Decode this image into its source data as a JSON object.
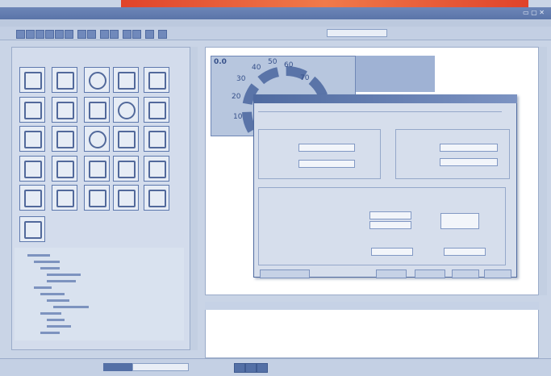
{
  "app": {
    "title_left": "",
    "title_right": "",
    "menu": []
  },
  "gauge": {
    "value_label": "0.0",
    "ticks": [
      "10",
      "20",
      "30",
      "40",
      "50",
      "60",
      "70"
    ]
  },
  "dialog": {
    "title": "",
    "buttons": []
  },
  "colors": {
    "accent": "#5a74a8",
    "banner": "#e0432a",
    "panel": "#d3dcec"
  }
}
